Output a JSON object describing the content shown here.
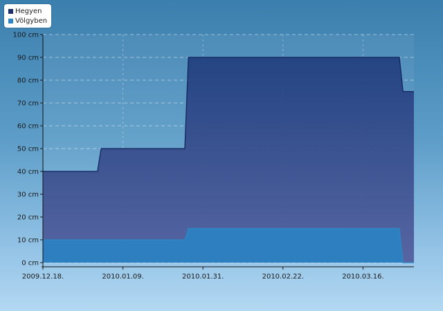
{
  "chart_data": {
    "type": "area",
    "x": [
      "2009-12-18",
      "2010-01-02",
      "2010-01-03",
      "2010-01-26",
      "2010-01-27",
      "2010-03-26",
      "2010-03-27",
      "2010-03-30"
    ],
    "series": [
      {
        "name": "Hegyen",
        "values": [
          40,
          40,
          50,
          50,
          90,
          90,
          75,
          75
        ],
        "color": "#1a2f6b"
      },
      {
        "name": "Völgyben",
        "values": [
          10,
          10,
          10,
          10,
          15,
          15,
          0,
          0
        ],
        "color": "#2e86c7"
      }
    ],
    "xticks": [
      "2009.12.18.",
      "2010.01.09.",
      "2010.01.31.",
      "2010.02.22.",
      "2010.03.16."
    ],
    "xtick_dates": [
      "2009-12-18",
      "2010-01-09",
      "2010-01-31",
      "2010-02-22",
      "2010-03-16"
    ],
    "yticks": [
      "0 cm",
      "10 cm",
      "20 cm",
      "30 cm",
      "40 cm",
      "50 cm",
      "60 cm",
      "70 cm",
      "80 cm",
      "90 cm",
      "100 cm"
    ],
    "ytick_values": [
      0,
      10,
      20,
      30,
      40,
      50,
      60,
      70,
      80,
      90,
      100
    ],
    "xlim": [
      "2009-12-18",
      "2010-03-30"
    ],
    "ylim": [
      0,
      100
    ],
    "grid": true,
    "legend_position": "top-left"
  }
}
